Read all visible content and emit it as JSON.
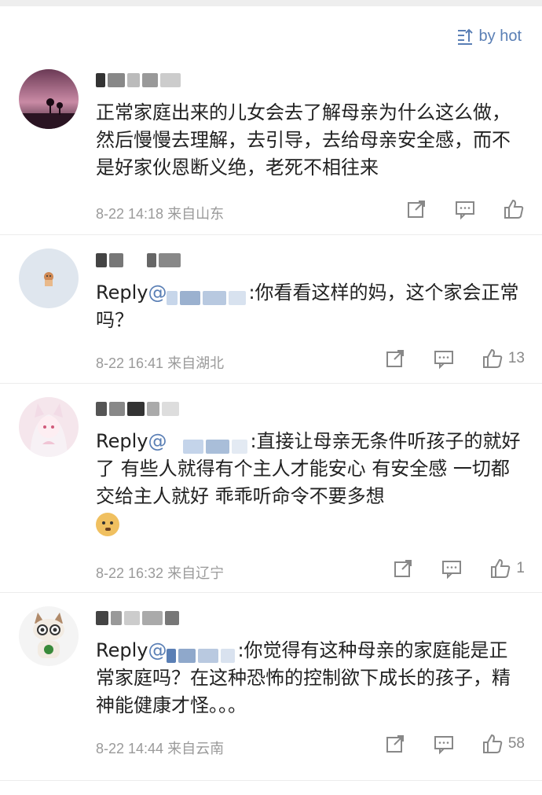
{
  "sort": {
    "label": "by hot",
    "icon": "sort-icon"
  },
  "comments": [
    {
      "text": "正常家庭出来的儿女会去了解母亲为什么这么做，然后慢慢去理解，去引导，去给母亲安全感，而不是好家伙恩断义绝，老死不相往来",
      "meta": "8-22 14:18  来自山东",
      "likes": ""
    },
    {
      "reply_prefix": "Reply",
      "reply_at": "@",
      "text": ":你看看这样的妈，这个家会正常吗？",
      "meta": "8-22 16:41  来自湖北",
      "likes": "13"
    },
    {
      "reply_prefix": "Reply",
      "reply_at": "@",
      "text": ":直接让母亲无条件听孩子的就好了 有些人就得有个主人才能安心 有安全感 一切都交给主人就好 乖乖听命令不要多想",
      "meta": "8-22 16:32  来自辽宁",
      "likes": "1"
    },
    {
      "reply_prefix": "Reply",
      "reply_at": "@",
      "text": ":你觉得有这种母亲的家庭能是正常家庭吗？在这种恐怖的控制欲下成长的孩子，精神能健康才怪。。。",
      "meta": "8-22 14:44  来自云南",
      "likes": "58"
    }
  ],
  "colors": {
    "link": "#5a7fb5",
    "meta": "#9a9a9a",
    "divider": "#ececec"
  }
}
